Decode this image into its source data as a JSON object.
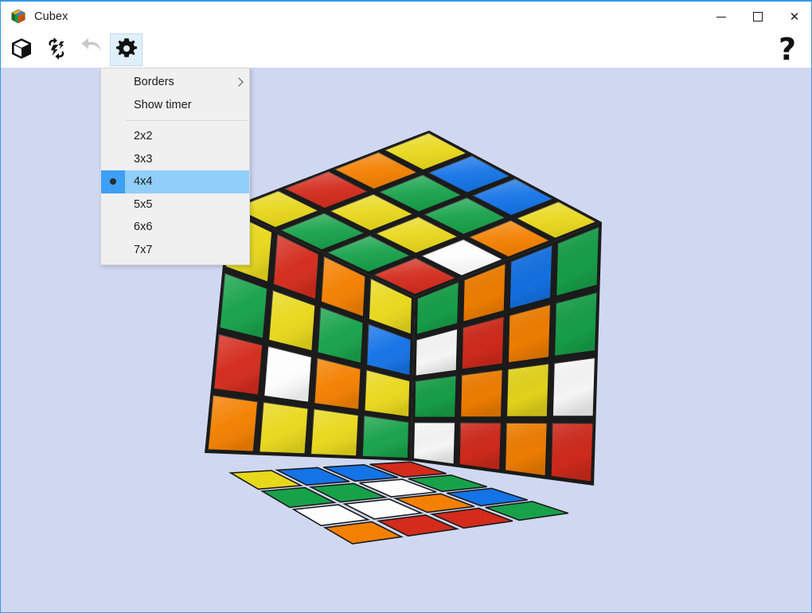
{
  "window": {
    "title": "Cubex",
    "icon": "rubiks-cube-icon",
    "accent_border": "#3399e8",
    "canvas_background": "#d0d8f1",
    "controls": {
      "minimize_label": "—",
      "maximize_label": "☐",
      "close_label": "✕"
    }
  },
  "toolbar": {
    "buttons": [
      {
        "name": "cube-view-button",
        "icon": "cube-icon",
        "label": "Cube",
        "enabled": true
      },
      {
        "name": "scramble-button",
        "icon": "scramble-icon",
        "label": "Scramble",
        "enabled": true
      },
      {
        "name": "undo-button",
        "icon": "undo-arrow-icon",
        "label": "Undo",
        "enabled": false
      },
      {
        "name": "settings-button",
        "icon": "gear-icon",
        "label": "Settings",
        "enabled": true,
        "active": true
      }
    ],
    "help": {
      "name": "help-button",
      "icon": "question-mark-icon",
      "label": "?"
    },
    "active_highlight_color": "#dff0fb"
  },
  "menu": {
    "open": true,
    "highlight_color": "#91cefa",
    "check_column_color": "#3da0f5",
    "background": "#f0f0f0",
    "items": [
      {
        "label": "Borders",
        "has_submenu": true,
        "selected": false,
        "type": "submenu"
      },
      {
        "label": "Show timer",
        "has_submenu": false,
        "selected": false,
        "type": "toggle"
      },
      {
        "type": "separator"
      },
      {
        "label": "2x2",
        "has_submenu": false,
        "selected": false,
        "type": "radio"
      },
      {
        "label": "3x3",
        "has_submenu": false,
        "selected": false,
        "type": "radio"
      },
      {
        "label": "4x4",
        "has_submenu": false,
        "selected": true,
        "type": "radio"
      },
      {
        "label": "5x5",
        "has_submenu": false,
        "selected": false,
        "type": "radio"
      },
      {
        "label": "6x6",
        "has_submenu": false,
        "selected": false,
        "type": "radio"
      },
      {
        "label": "7x7",
        "has_submenu": false,
        "selected": false,
        "type": "radio"
      }
    ],
    "selected_value": "4x4"
  },
  "cube": {
    "size": 4,
    "palette": {
      "white": "#fdfdfd",
      "yellow": "#e8d81c",
      "red": "#d32b1c",
      "orange": "#f38000",
      "green": "#17a24a",
      "blue": "#1473e6",
      "border": "#1b1b1b"
    },
    "faces": {
      "top": [
        [
          "yellow",
          "red",
          "orange",
          "yellow"
        ],
        [
          "green",
          "yellow",
          "green",
          "blue"
        ],
        [
          "green",
          "yellow",
          "green",
          "blue"
        ],
        [
          "red",
          "white",
          "orange",
          "yellow"
        ]
      ],
      "left": [
        [
          "yellow",
          "red",
          "orange",
          "yellow"
        ],
        [
          "green",
          "yellow",
          "green",
          "blue"
        ],
        [
          "red",
          "white",
          "orange",
          "yellow"
        ],
        [
          "orange",
          "yellow",
          "yellow",
          "green"
        ]
      ],
      "right": [
        [
          "green",
          "orange",
          "blue",
          "green"
        ],
        [
          "white",
          "red",
          "orange",
          "green"
        ],
        [
          "green",
          "orange",
          "yellow",
          "white"
        ],
        [
          "white",
          "red",
          "orange",
          "red"
        ]
      ],
      "bottom": [
        [
          "yellow",
          "blue",
          "blue",
          "red"
        ],
        [
          "green",
          "green",
          "white",
          "green"
        ],
        [
          "white",
          "white",
          "orange",
          "blue"
        ],
        [
          "orange",
          "red",
          "red",
          "green"
        ]
      ]
    }
  }
}
